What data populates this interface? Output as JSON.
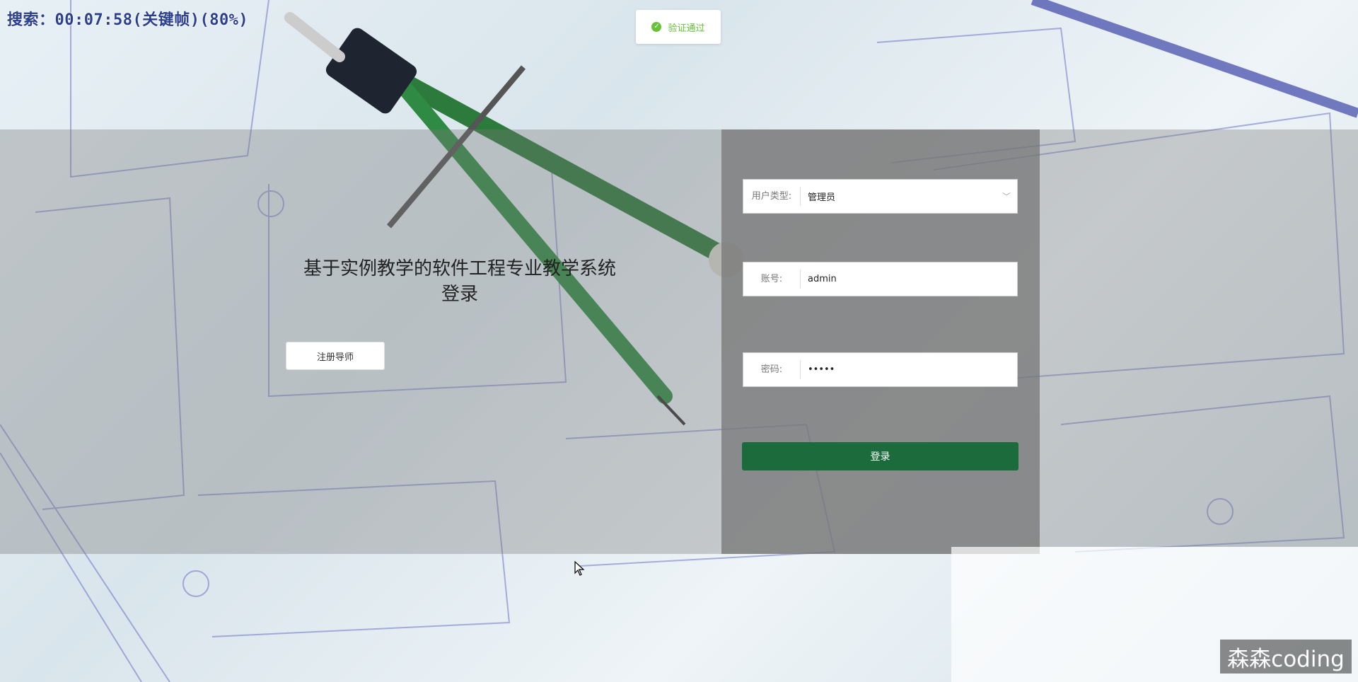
{
  "status_bar": {
    "search_status": "搜索：00:07:58(关键帧)(80%)"
  },
  "toast": {
    "icon": "check-circle-icon",
    "message": "验证通过",
    "color": "#67c23a"
  },
  "left": {
    "title_line1": "基于实例教学的软件工程专业教学系统",
    "title_line2": "登录",
    "register_button": "注册导师"
  },
  "form": {
    "user_type_label": "用户类型:",
    "user_type_value": "管理员",
    "account_label": "账号:",
    "account_value": "admin",
    "password_label": "密码:",
    "password_value": "•••••",
    "login_button": "登录",
    "login_color": "#1b6b3d"
  },
  "watermark": {
    "text": "森森coding"
  }
}
